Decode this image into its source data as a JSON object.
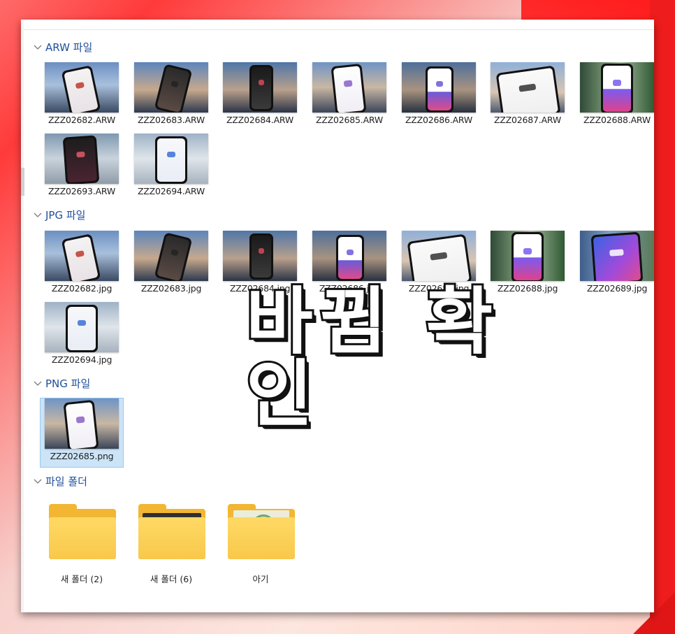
{
  "overlay_text": "바뀜 확인",
  "groups": [
    {
      "header": "ARW 파일",
      "items": [
        {
          "name": "ZZZ02682.ARW",
          "scene": "phone-profile"
        },
        {
          "name": "ZZZ02683.ARW",
          "scene": "phone-portrait"
        },
        {
          "name": "ZZZ02684.ARW",
          "scene": "phone-grid"
        },
        {
          "name": "ZZZ02685.ARW",
          "scene": "phone-white"
        },
        {
          "name": "ZZZ02686.ARW",
          "scene": "phone-app"
        },
        {
          "name": "ZZZ02687.ARW",
          "scene": "phone-closeup"
        },
        {
          "name": "ZZZ02688.ARW",
          "scene": "phone-green"
        },
        {
          "name": "ZZZ02693.ARW",
          "scene": "phone-hand"
        },
        {
          "name": "ZZZ02694.ARW",
          "scene": "phone-search"
        }
      ]
    },
    {
      "header": "JPG 파일",
      "items": [
        {
          "name": "ZZZ02682.jpg",
          "scene": "phone-profile"
        },
        {
          "name": "ZZZ02683.jpg",
          "scene": "phone-portrait"
        },
        {
          "name": "ZZZ02684.jpg",
          "scene": "phone-grid"
        },
        {
          "name": "ZZZ02686.jpg",
          "scene": "phone-app"
        },
        {
          "name": "ZZZ02687.jpg",
          "scene": "phone-closeup"
        },
        {
          "name": "ZZZ02688.jpg",
          "scene": "phone-green"
        },
        {
          "name": "ZZZ02689.jpg",
          "scene": "phone-blue"
        },
        {
          "name": "ZZZ02694.jpg",
          "scene": "phone-search"
        }
      ]
    },
    {
      "header": "PNG 파일",
      "items": [
        {
          "name": "ZZZ02685.png",
          "scene": "phone-white",
          "selected": true
        }
      ]
    },
    {
      "header": "파일 폴더",
      "folders": [
        {
          "name": "새 폴더 (2)",
          "preview": "empty"
        },
        {
          "name": "새 폴더 (6)",
          "preview": "dark-device"
        },
        {
          "name": "아기",
          "preview": "baby-photo"
        }
      ]
    }
  ],
  "colors": {
    "group_header": "#1f4f9a",
    "selection_bg": "#cce4f7",
    "folder": "#f8c84a",
    "accent_red": "#ee1c1c"
  }
}
